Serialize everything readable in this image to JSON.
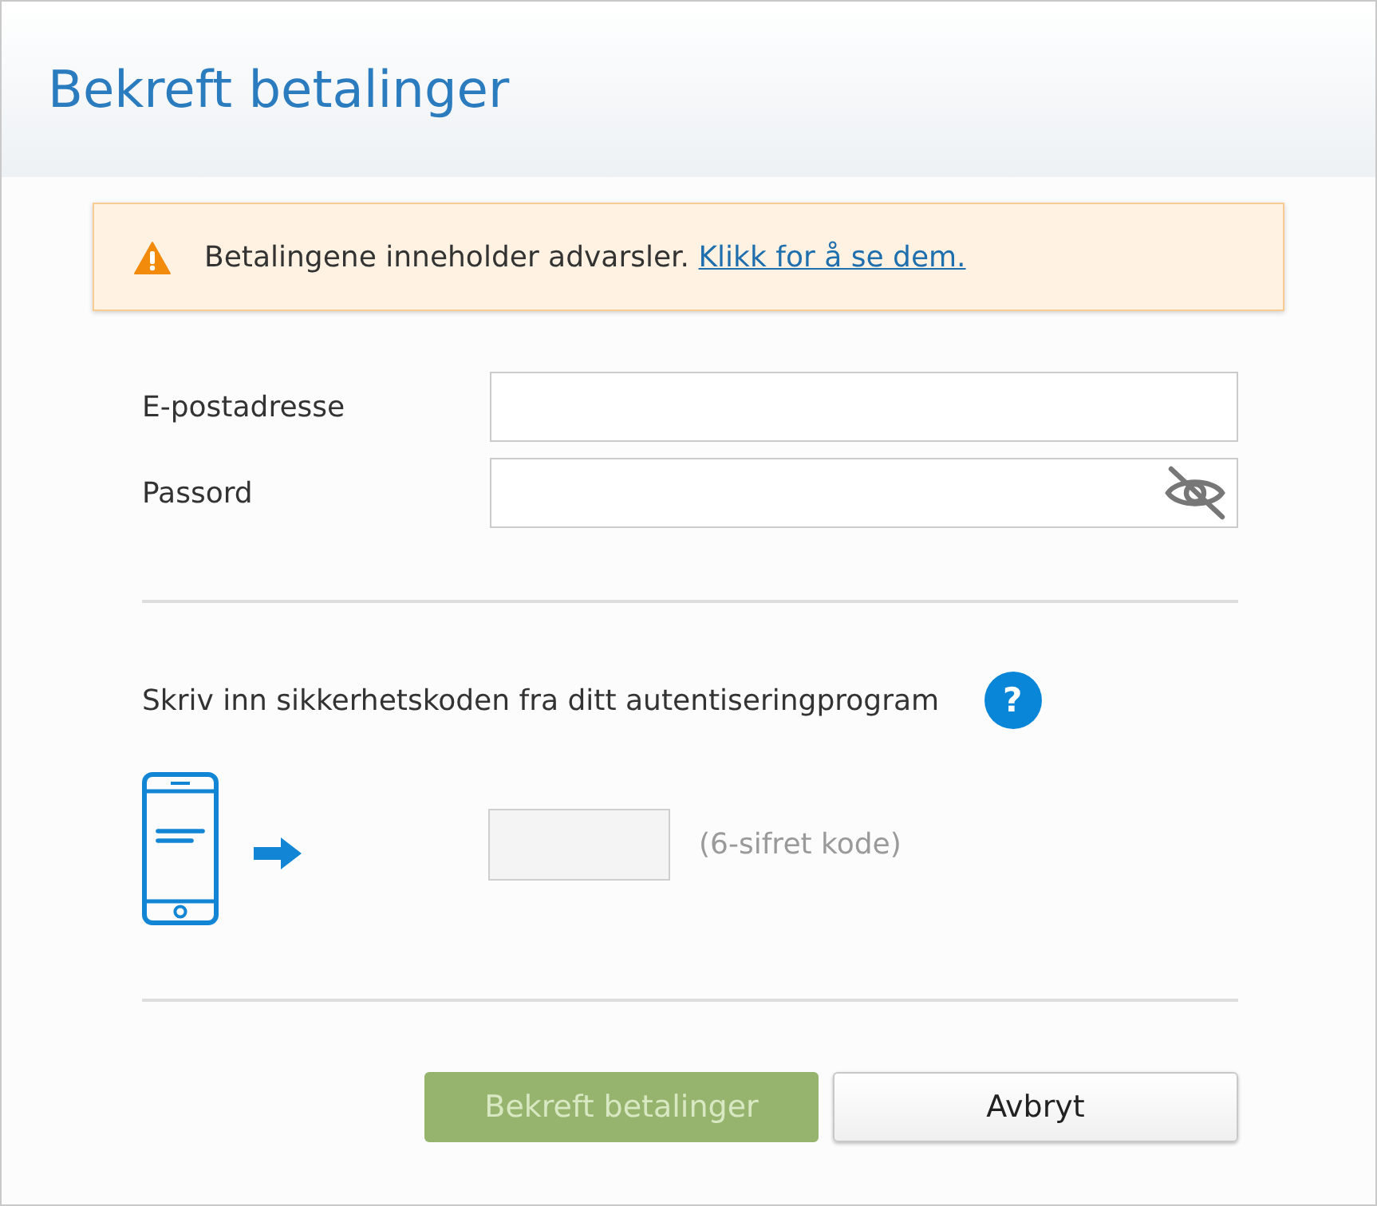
{
  "window": {
    "title": "Bekreft betalinger"
  },
  "warning": {
    "text": "Betalingene inneholder advarsler.",
    "link": "Klikk for å se dem."
  },
  "fields": [
    {
      "label": "E-postadresse",
      "kind": "text"
    },
    {
      "label": "Passord",
      "kind": "password"
    }
  ],
  "security_code": {
    "prompt": "Skriv inn sikkerhetskoden fra ditt autentiseringprogram",
    "help": "?",
    "hint": "(6-sifret kode)"
  },
  "buttons": [
    {
      "label": "Bekreft betalinger",
      "kind": "primary",
      "disabled": true
    },
    {
      "label": "Avbryt",
      "kind": "secondary",
      "disabled": false
    }
  ]
}
